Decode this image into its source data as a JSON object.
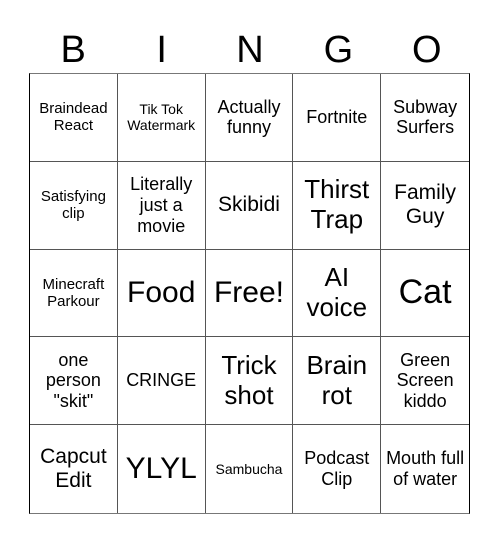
{
  "header": {
    "letters": [
      "B",
      "I",
      "N",
      "G",
      "O"
    ]
  },
  "grid": {
    "rows": [
      [
        {
          "text": "Braindead React"
        },
        {
          "text": "Tik Tok Watermark"
        },
        {
          "text": "Actually funny"
        },
        {
          "text": "Fortnite"
        },
        {
          "text": "Subway Surfers"
        }
      ],
      [
        {
          "text": "Satisfying clip"
        },
        {
          "text": "Literally just a movie"
        },
        {
          "text": "Skibidi"
        },
        {
          "text": "Thirst Trap"
        },
        {
          "text": "Family Guy"
        }
      ],
      [
        {
          "text": "Minecraft Parkour"
        },
        {
          "text": "Food"
        },
        {
          "text": "Free!"
        },
        {
          "text": "AI voice"
        },
        {
          "text": "Cat"
        }
      ],
      [
        {
          "text": "one person \"skit\""
        },
        {
          "text": "CRINGE"
        },
        {
          "text": "Trick shot"
        },
        {
          "text": "Brain rot"
        },
        {
          "text": "Green Screen kiddo"
        }
      ],
      [
        {
          "text": "Capcut Edit"
        },
        {
          "text": "YLYL"
        },
        {
          "text": "Sambucha"
        },
        {
          "text": "Podcast Clip"
        },
        {
          "text": "Mouth full of water"
        }
      ]
    ]
  }
}
